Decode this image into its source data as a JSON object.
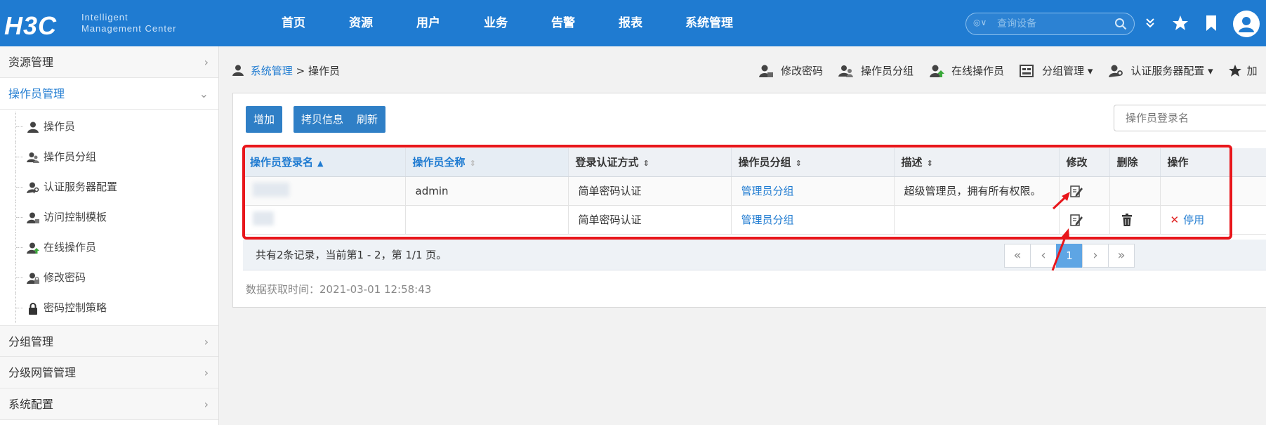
{
  "header": {
    "logo_mark": "H3C",
    "logo_sub_1": "Intelligent",
    "logo_sub_2": "Management Center",
    "nav": [
      "首页",
      "资源",
      "用户",
      "业务",
      "告警",
      "报表",
      "系统管理"
    ],
    "search_placeholder": "查询设备",
    "search_scope": "◎∨"
  },
  "sidebar": {
    "groups_top": [
      {
        "label": "资源管理",
        "state": "collapsed"
      },
      {
        "label": "操作员管理",
        "state": "expanded"
      }
    ],
    "sub_items": [
      {
        "label": "操作员",
        "icon": "user-icon"
      },
      {
        "label": "操作员分组",
        "icon": "user-group-icon"
      },
      {
        "label": "认证服务器配置",
        "icon": "user-key-icon"
      },
      {
        "label": "访问控制模板",
        "icon": "user-template-icon"
      },
      {
        "label": "在线操作员",
        "icon": "user-online-icon"
      },
      {
        "label": "修改密码",
        "icon": "user-lock-icon"
      },
      {
        "label": "密码控制策略",
        "icon": "lock-icon"
      }
    ],
    "groups_bottom": [
      {
        "label": "分组管理"
      },
      {
        "label": "分级网管管理"
      },
      {
        "label": "系统配置"
      }
    ]
  },
  "breadcrumb": {
    "parent": "系统管理",
    "separator": ">",
    "current": "操作员"
  },
  "toolbar_links": [
    {
      "label": "修改密码",
      "icon": "user-lock-icon"
    },
    {
      "label": "操作员分组",
      "icon": "user-group-icon"
    },
    {
      "label": "在线操作员",
      "icon": "user-online-icon"
    },
    {
      "label": "分组管理 ▾",
      "icon": "group-manage-icon"
    },
    {
      "label": "认证服务器配置 ▾",
      "icon": "user-key-icon"
    },
    {
      "label": "加",
      "icon": "star-add-icon"
    }
  ],
  "buttons": {
    "add": "增加",
    "copy": "拷贝信息",
    "refresh": "刷新"
  },
  "filter_placeholder": "操作员登录名",
  "table": {
    "columns": [
      "操作员登录名",
      "操作员全称",
      "登录认证方式",
      "操作员分组",
      "描述",
      "修改",
      "删除",
      "操作"
    ],
    "rows": [
      {
        "login": "",
        "fullname": "admin",
        "auth": "简单密码认证",
        "group": "管理员分组",
        "desc": "超级管理员，拥有所有权限。",
        "edit": true,
        "delete": false,
        "op": ""
      },
      {
        "login": "",
        "fullname": "",
        "auth": "简单密码认证",
        "group": "管理员分组",
        "desc": "",
        "edit": true,
        "delete": true,
        "op": "停用"
      }
    ]
  },
  "summary": "共有2条记录，当前第1 - 2，第 1/1 页。",
  "pager": {
    "first": "«",
    "prev": "‹",
    "current": "1",
    "next": "›",
    "last": "»"
  },
  "fetch_time": "数据获取时间：2021-03-01 12:58:43",
  "colors": {
    "header": "#1f7bd1",
    "button": "#2f7fc6",
    "annotation": "#e8161b"
  }
}
